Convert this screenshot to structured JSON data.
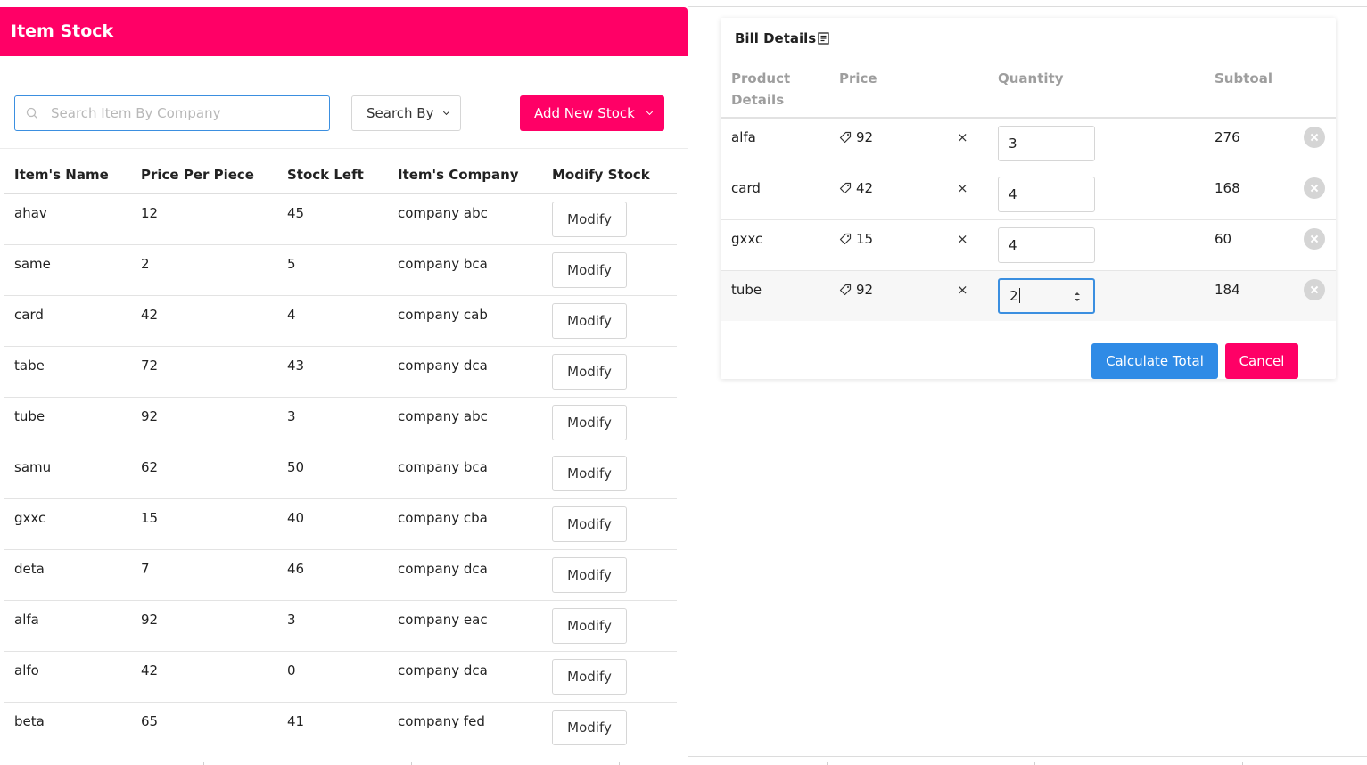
{
  "stock_panel": {
    "title": "Item Stock",
    "search_placeholder": "Search Item By Company",
    "search_by_label": "Search By",
    "add_button_label": "Add New Stock",
    "headers": [
      "Item's Name",
      "Price Per Piece",
      "Stock Left",
      "Item's Company",
      "Modify Stock"
    ],
    "modify_label": "Modify",
    "rows": [
      {
        "name": "ahav",
        "price": "12",
        "stock": "45",
        "company": "company abc"
      },
      {
        "name": "same",
        "price": "2",
        "stock": "5",
        "company": "company bca"
      },
      {
        "name": "card",
        "price": "42",
        "stock": "4",
        "company": "company cab"
      },
      {
        "name": "tabe",
        "price": "72",
        "stock": "43",
        "company": "company dca"
      },
      {
        "name": "tube",
        "price": "92",
        "stock": "3",
        "company": "company abc"
      },
      {
        "name": "samu",
        "price": "62",
        "stock": "50",
        "company": "company bca"
      },
      {
        "name": "gxxc",
        "price": "15",
        "stock": "40",
        "company": "company cba"
      },
      {
        "name": "deta",
        "price": "7",
        "stock": "46",
        "company": "company dca"
      },
      {
        "name": "alfa",
        "price": "92",
        "stock": "3",
        "company": "company eac"
      },
      {
        "name": "alfo",
        "price": "42",
        "stock": "0",
        "company": "company dca"
      },
      {
        "name": "beta",
        "price": "65",
        "stock": "41",
        "company": "company fed"
      }
    ]
  },
  "bill": {
    "title": "Bill Details",
    "headers": {
      "product_line1": "Product",
      "product_line2": "Details",
      "price": "Price",
      "quantity": "Quantity",
      "subtotal": "Subtoal"
    },
    "times_symbol": "×",
    "rows": [
      {
        "name": "alfa",
        "price": "92",
        "quantity": "3",
        "subtotal": "276"
      },
      {
        "name": "card",
        "price": "42",
        "quantity": "4",
        "subtotal": "168"
      },
      {
        "name": "gxxc",
        "price": "15",
        "quantity": "4",
        "subtotal": "60"
      },
      {
        "name": "tube",
        "price": "92",
        "quantity": "2",
        "subtotal": "184"
      }
    ],
    "calculate_label": "Calculate Total",
    "cancel_label": "Cancel"
  },
  "colors": {
    "accent": "#ff0066",
    "primary": "#2f8be6"
  }
}
